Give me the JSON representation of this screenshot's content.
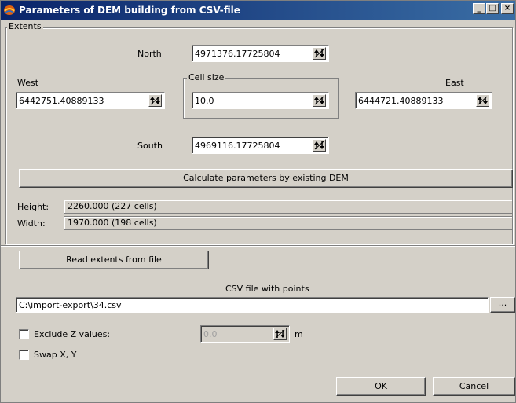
{
  "window": {
    "title": "Parameters of DEM building from CSV-file",
    "controls": {
      "minimize": "_",
      "maximize": "□",
      "close": "×"
    }
  },
  "extents": {
    "title": "Extents",
    "north": {
      "label": "North",
      "value": "4971376.17725804"
    },
    "west": {
      "label": "West",
      "value": "6442751.40889133"
    },
    "east": {
      "label": "East",
      "value": "6444721.40889133"
    },
    "south": {
      "label": "South",
      "value": "4969116.17725804"
    },
    "cell_size": {
      "label": "Cell size",
      "value": "10.0"
    },
    "calculate_button": "Calculate parameters by existing DEM"
  },
  "info": {
    "height_label": "Height:",
    "height_value": "2260.000 (227 cells)",
    "width_label": "Width:",
    "width_value": "1970.000 (198 cells)"
  },
  "read_extents_button": "Read extents from file",
  "csv": {
    "label": "CSV file with points",
    "path": "C:\\import-export\\34.csv",
    "browse_label": "..."
  },
  "options": {
    "exclude_z_label": "Exclude Z values:",
    "exclude_z_value": "0.0",
    "unit": "m",
    "swap_xy_label": "Swap X, Y"
  },
  "footer": {
    "ok": "OK",
    "cancel": "Cancel"
  },
  "icons": {
    "app": "dem-app-icon",
    "spin": "spin-arrows-icon"
  },
  "colors": {
    "titlebar_start": "#0a246a",
    "titlebar_end": "#3a6ea5",
    "dialog_bg": "#d4d0c8"
  }
}
